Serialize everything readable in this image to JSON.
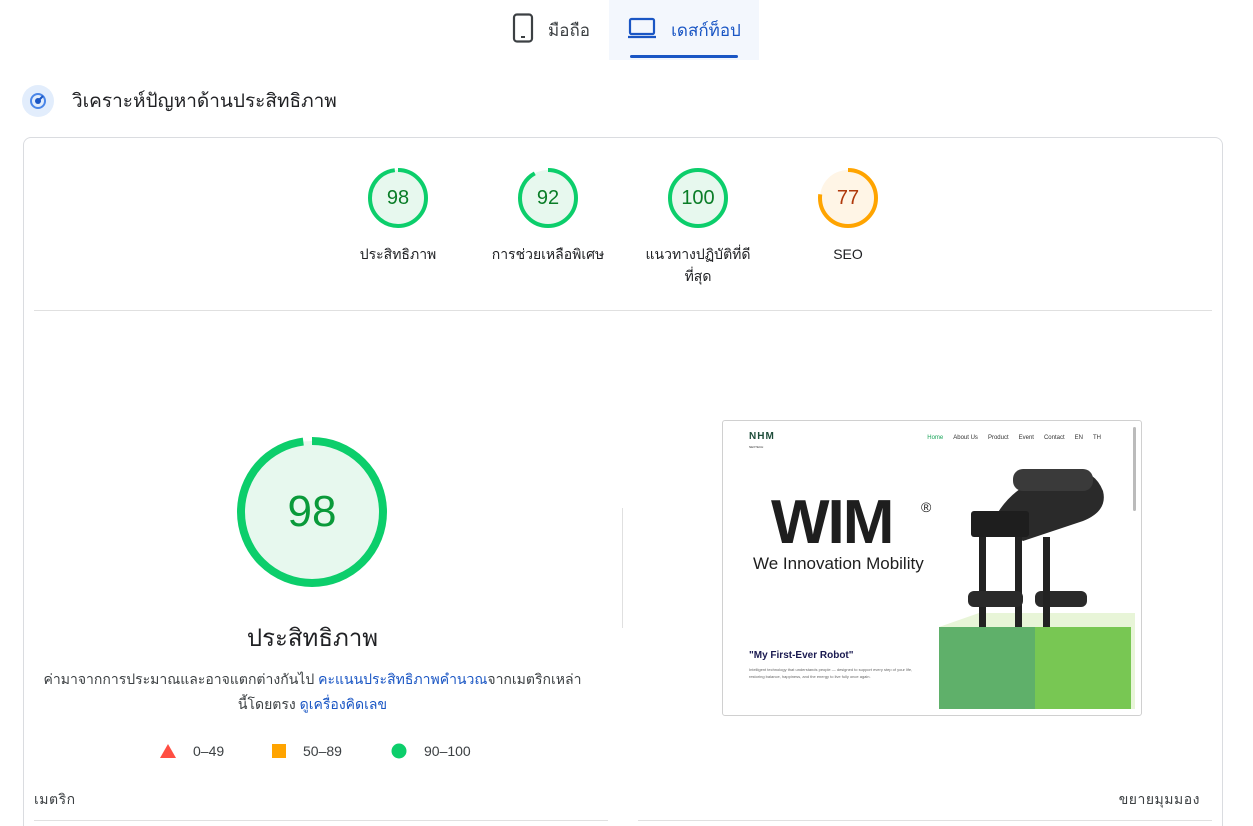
{
  "tabs": {
    "mobile_label": "มือถือ",
    "desktop_label": "เดสก์ท็อป",
    "active": "desktop"
  },
  "section": {
    "title": "วิเคราะห์ปัญหาด้านประสิทธิภาพ"
  },
  "gauges": [
    {
      "score": "98",
      "label": "ประสิทธิภาพ",
      "rating": "pass",
      "fraction": 0.98
    },
    {
      "score": "92",
      "label": "การช่วยเหลือพิเศษ",
      "rating": "pass",
      "fraction": 0.92
    },
    {
      "score": "100",
      "label_line1": "แนวทางปฏิบัติที่ดี",
      "label_line2": "ที่สุด",
      "rating": "pass",
      "fraction": 1.0
    },
    {
      "score": "77",
      "label": "SEO",
      "rating": "average",
      "fraction": 0.77
    }
  ],
  "performance": {
    "score": "98",
    "fraction": 0.98,
    "title": "ประสิทธิภาพ",
    "desc_part1": "ค่ามาจากการประมาณและอาจแตกต่างกันไป ",
    "desc_link1": "คะแนนประสิทธิภาพคำนวณ",
    "desc_part2": "จากเมตริกเหล่านี้โดยตรง ",
    "desc_link2": "ดูเครื่องคิดเลข"
  },
  "legend": {
    "fail": "0–49",
    "average": "50–89",
    "pass": "90–100"
  },
  "metrics": {
    "label": "เมตริก",
    "expand": "ขยายมุมมอง"
  },
  "thumbnail": {
    "logo": "NHM",
    "logo_sub": "NEXTECH",
    "nav": [
      "Home",
      "About Us",
      "Product",
      "Event",
      "Contact",
      "EN",
      "TH"
    ],
    "brand": "WIM",
    "reg": "®",
    "tagline": "We Innovation Mobility",
    "quote": "\"My First-Ever Robot\"",
    "body": "Intelligent technology that understands people — designed to support every step of your life, restoring balance, happiness, and the energy to live fully once again."
  },
  "colors": {
    "pass": "#0cce6b",
    "pass_fill": "#e7f8ee",
    "average": "#ffa400",
    "average_fill": "#fff5e6",
    "fail": "#ff4e42",
    "accent": "#1a56c4"
  }
}
